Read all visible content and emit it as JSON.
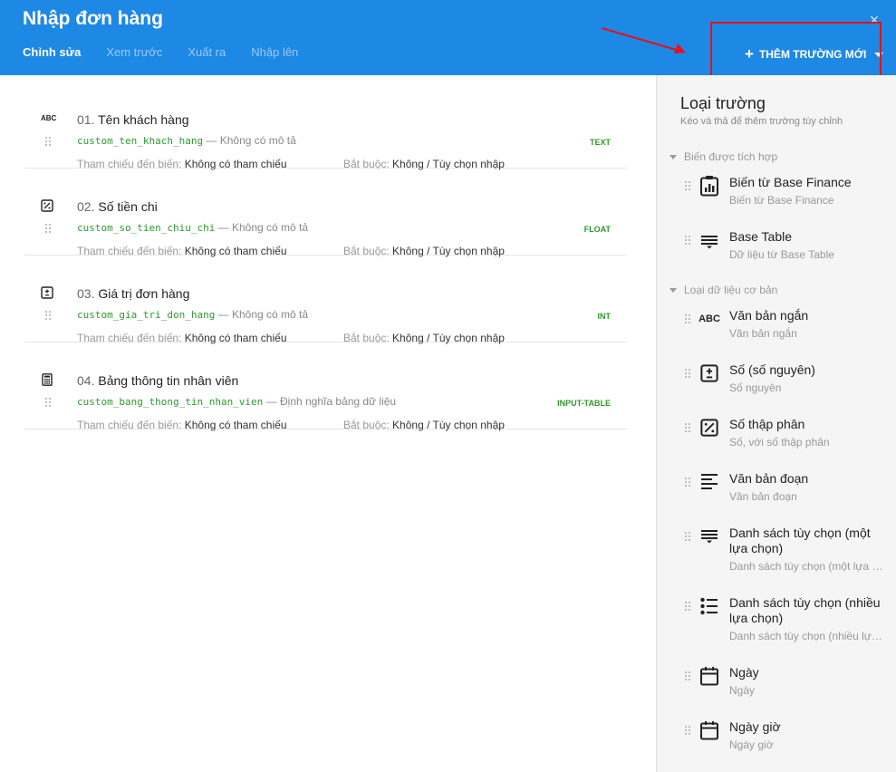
{
  "header": {
    "title": "Nhập đơn hàng",
    "tabs": [
      "Chỉnh sửa",
      "Xem trước",
      "Xuất ra",
      "Nhập lên"
    ],
    "add_field_label": "THÊM TRƯỜNG MỚI",
    "close_glyph": "×"
  },
  "fields": [
    {
      "num": "01.",
      "name": "Tên khách hàng",
      "code": "custom_ten_khach_hang",
      "desc": " — Không có mô tả",
      "type": "TEXT",
      "ref_label": "Tham chiếu đến biến:",
      "ref_value": "Không có tham chiếu",
      "req_label": "Bắt buộc:",
      "req_value": "Không / Tùy chọn nhập",
      "icon": "abc-icon",
      "icon_text": "ABC"
    },
    {
      "num": "02.",
      "name": "Số tiền chi",
      "code": "custom_so_tien_chiu_chi",
      "desc": " — Không có mô tả",
      "type": "FLOAT",
      "ref_label": "Tham chiếu đến biến:",
      "ref_value": "Không có tham chiếu",
      "req_label": "Bắt buộc:",
      "req_value": "Không / Tùy chọn nhập",
      "icon": "percent-icon"
    },
    {
      "num": "03.",
      "name": "Giá trị đơn hàng",
      "code": "custom_gia_tri_don_hang",
      "desc": " — Không có mô tả",
      "type": "INT",
      "ref_label": "Tham chiếu đến biến:",
      "ref_value": "Không có tham chiếu",
      "req_label": "Bắt buộc:",
      "req_value": "Không / Tùy chọn nhập",
      "icon": "plus-minus-icon"
    },
    {
      "num": "04.",
      "name": "Bảng thông tin nhân viên",
      "code": "custom_bang_thong_tin_nhan_vien",
      "desc": " — Định nghĩa bảng dữ liệu",
      "type": "INPUT-TABLE",
      "ref_label": "Tham chiếu đến biến:",
      "ref_value": "Không có tham chiếu",
      "req_label": "Bắt buộc:",
      "req_value": "Không / Tùy chọn nhập",
      "icon": "calculator-icon"
    }
  ],
  "sidebar": {
    "title": "Loại trường",
    "subtitle": "Kéo và thả để thêm trường tùy chỉnh",
    "groups": [
      {
        "label": "Biến được tích hợp"
      },
      {
        "label": "Loại dữ liệu cơ bản"
      }
    ],
    "items": [
      {
        "name": "Biến từ Base Finance",
        "desc": "Biến từ Base Finance",
        "icon": "finance-clipboard-icon"
      },
      {
        "name": "Base Table",
        "desc": "Dữ liệu từ Base Table",
        "icon": "table-lines-icon"
      },
      {
        "name": "Văn bản ngắn",
        "desc": "Văn bản ngắn",
        "icon": "abc-icon",
        "icon_text": "ABC"
      },
      {
        "name": "Số (số nguyên)",
        "desc": "Số nguyên",
        "icon": "plus-minus-icon"
      },
      {
        "name": "Số thập phân",
        "desc": "Số, với số thập phân",
        "icon": "percent-icon"
      },
      {
        "name": "Văn bản đoạn",
        "desc": "Văn bản đoạn",
        "icon": "paragraph-icon"
      },
      {
        "name": "Danh sách tùy chọn (một lựa chọn)",
        "desc": "Danh sách tùy chọn (một lựa chọn)",
        "icon": "single-select-icon"
      },
      {
        "name": "Danh sách tùy chọn (nhiều lựa chọn)",
        "desc": "Danh sách tùy chọn (nhiều lựa chọn)",
        "icon": "multi-select-icon"
      },
      {
        "name": "Ngày",
        "desc": "Ngày",
        "icon": "calendar-icon"
      },
      {
        "name": "Ngày giờ",
        "desc": "Ngày giờ",
        "icon": "calendar-time-icon"
      }
    ]
  },
  "colors": {
    "header": "#1e88e5",
    "code_green": "#2e9a2e",
    "highlight_red": "#e8101a"
  }
}
